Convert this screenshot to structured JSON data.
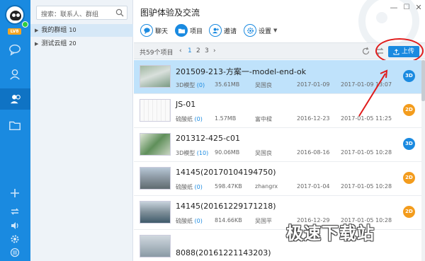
{
  "window": {
    "title": "图驴体验及交流"
  },
  "user": {
    "level_badge": "LV8"
  },
  "search": {
    "placeholder": "搜索：联系人、群组"
  },
  "groups": [
    {
      "name": "我的群组",
      "count": "10",
      "selected": true
    },
    {
      "name": "测试云组",
      "count": "20",
      "selected": false
    }
  ],
  "actions": [
    {
      "label": "聊天",
      "icon": "chat-icon"
    },
    {
      "label": "项目",
      "icon": "folder-icon"
    },
    {
      "label": "邀请",
      "icon": "invite-icon"
    },
    {
      "label": "设置",
      "icon": "gear-icon"
    }
  ],
  "toolbar": {
    "total": "共59个项目",
    "pages": [
      "1",
      "2",
      "3"
    ],
    "current_page": "1",
    "upload_label": "上传"
  },
  "files": [
    {
      "name": "201509-213-方案一-model-end-ok",
      "type": "3D模型",
      "count": "(0)",
      "size": "35.61MB",
      "author": "吴国良",
      "created": "2017-01-09",
      "modified": "2017-01-09 13:07",
      "badge": "3D"
    },
    {
      "name": "JS-01",
      "type": "硫酸纸",
      "count": "(0)",
      "size": "1.57MB",
      "author": "富中樑",
      "created": "2016-12-23",
      "modified": "2017-01-05 11:25",
      "badge": "2D"
    },
    {
      "name": "201312-425-c01",
      "type": "3D模型",
      "count": "(10)",
      "size": "90.06MB",
      "author": "吴国良",
      "created": "2016-08-16",
      "modified": "2017-01-05 10:28",
      "badge": "3D"
    },
    {
      "name": "14145(20170104194750)",
      "type": "硫酸纸",
      "count": "(0)",
      "size": "598.47KB",
      "author": "zhangrx",
      "created": "2017-01-04",
      "modified": "2017-01-05 10:28",
      "badge": "2D"
    },
    {
      "name": "14145(20161229171218)",
      "type": "硫酸纸",
      "count": "(0)",
      "size": "814.66KB",
      "author": "吴国平",
      "created": "2016-12-29",
      "modified": "2017-01-05 10:28",
      "badge": "2D"
    },
    {
      "name": "8088(20161221143203)",
      "type": "",
      "count": "",
      "size": "",
      "author": "",
      "created": "",
      "modified": "",
      "badge": ""
    }
  ],
  "watermark": "极速下载站",
  "colors": {
    "rail": "#1a8ae0",
    "accent": "#1a8ae0",
    "badge_3d": "#1a8ae0",
    "badge_2d": "#f39c1d",
    "annotation": "#e01b1b"
  }
}
